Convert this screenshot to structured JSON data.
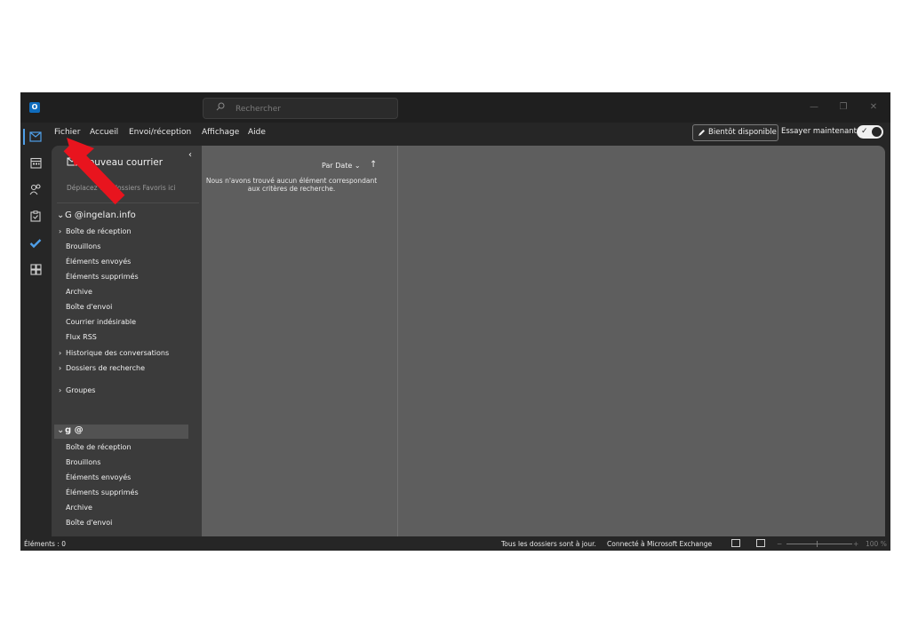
{
  "titlebar": {
    "search_placeholder": "Rechercher",
    "logo_letter": "O"
  },
  "menu": {
    "items": [
      "Fichier",
      "Accueil",
      "Envoi/réception",
      "Affichage",
      "Aide"
    ],
    "soon_button": "Bientôt disponible",
    "try_now": "Essayer maintenant",
    "toggle_on": true
  },
  "folder_pane": {
    "new_mail": "Nouveau courrier",
    "favorites_hint": "Déplacez vos dossiers Favoris ici",
    "account1": {
      "name": "G                @ingelan.info",
      "folders": [
        {
          "label": "Boîte de réception",
          "expandable": true
        },
        {
          "label": "Brouillons",
          "expandable": false
        },
        {
          "label": "Éléments envoyés",
          "expandable": false
        },
        {
          "label": "Éléments supprimés",
          "expandable": false
        },
        {
          "label": "Archive",
          "expandable": false
        },
        {
          "label": "Boîte d'envoi",
          "expandable": false
        },
        {
          "label": "Courrier indésirable",
          "expandable": false
        },
        {
          "label": "Flux RSS",
          "expandable": false
        },
        {
          "label": "Historique des conversations",
          "expandable": true
        },
        {
          "label": "Dossiers de recherche",
          "expandable": true
        }
      ],
      "groups": "Groupes"
    },
    "account2": {
      "name": "g                        @",
      "folders": [
        {
          "label": "Boîte de réception"
        },
        {
          "label": "Brouillons"
        },
        {
          "label": "Éléments envoyés"
        },
        {
          "label": "Éléments supprimés"
        },
        {
          "label": "Archive"
        },
        {
          "label": "Boîte d'envoi"
        }
      ]
    }
  },
  "message_list": {
    "sort_label": "Par Date",
    "empty_message": "Nous n'avons trouvé aucun élément correspondant aux critères de recherche."
  },
  "statusbar": {
    "items_count": "Éléments : 0",
    "sync_status": "Tous les dossiers sont à jour.",
    "connection": "Connecté à Microsoft Exchange",
    "zoom": "100 %"
  },
  "colors": {
    "accent": "#4f9fe8",
    "annotation_arrow": "#e8141e",
    "window_bg": "#262626",
    "pane_bg": "#5e5e5e"
  }
}
